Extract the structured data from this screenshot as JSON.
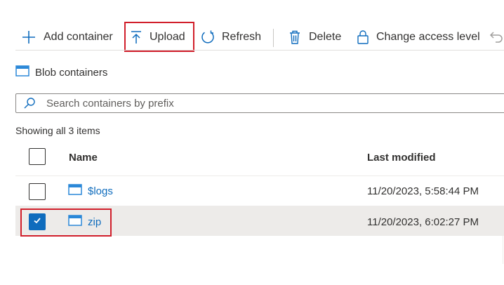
{
  "toolbar": {
    "add_container": "Add container",
    "upload": "Upload",
    "refresh": "Refresh",
    "delete": "Delete",
    "change_access_level": "Change access level"
  },
  "section": {
    "title": "Blob containers"
  },
  "search": {
    "placeholder": "Search containers by prefix",
    "value": ""
  },
  "list": {
    "count_text": "Showing all 3 items",
    "columns": {
      "name": "Name",
      "last_modified": "Last modified"
    },
    "rows": [
      {
        "name": "$logs",
        "last_modified": "11/20/2023, 5:58:44 PM",
        "checked": false
      },
      {
        "name": "zip",
        "last_modified": "11/20/2023, 6:02:27 PM",
        "checked": true
      }
    ]
  },
  "colors": {
    "accent": "#0f6cbd",
    "highlight_border": "#d11f2b",
    "selected_row": "#edebe9",
    "container_icon": "#2b88d8"
  },
  "icons": [
    "plus-icon",
    "upload-icon",
    "refresh-icon",
    "trash-icon",
    "lock-icon",
    "undo-icon",
    "container-icon",
    "search-icon",
    "checkmark-icon"
  ]
}
